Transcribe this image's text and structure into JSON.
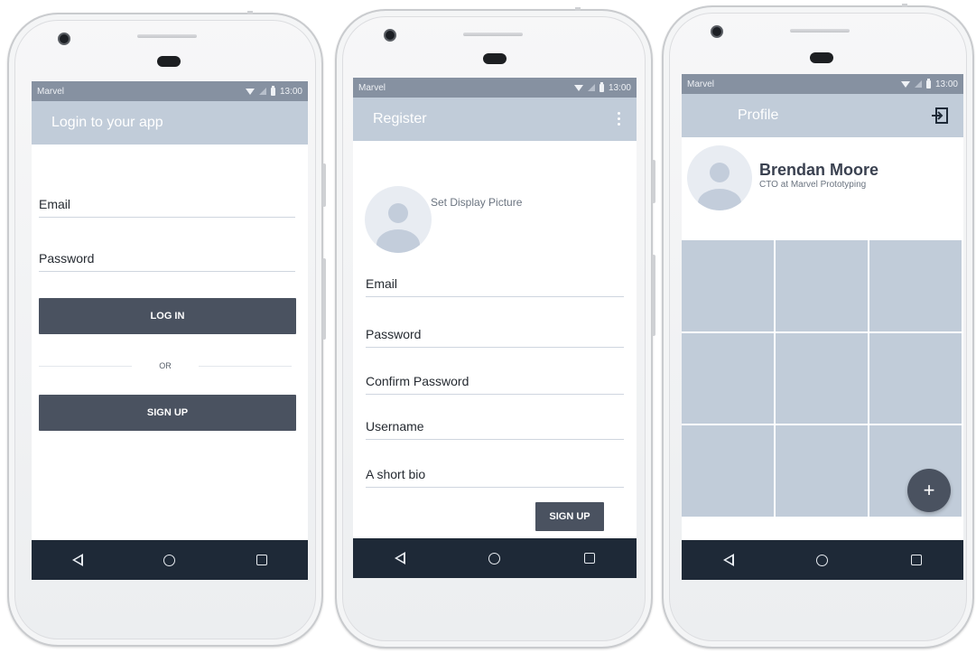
{
  "status_bar": {
    "carrier": "Marvel",
    "time": "13:00"
  },
  "login": {
    "title": "Login to your app",
    "email_label": "Email",
    "password_label": "Password",
    "login_button": "LOG IN",
    "or_label": "OR",
    "signup_button": "SIGN UP"
  },
  "register": {
    "title": "Register",
    "set_picture_label": "Set Display Picture",
    "email_label": "Email",
    "password_label": "Password",
    "confirm_password_label": "Confirm Password",
    "username_label": "Username",
    "bio_label": "A short bio",
    "signup_button": "SIGN UP"
  },
  "profile": {
    "title": "Profile",
    "name": "Brendan Moore",
    "subtitle": "CTO at Marvel Prototyping",
    "fab_label": "+"
  },
  "icons": {
    "status": [
      "wifi-icon",
      "signal-icon",
      "battery-icon"
    ],
    "nav": [
      "back-icon",
      "home-icon",
      "recent-apps-icon"
    ],
    "appbar": [
      "more-vert-icon",
      "exit-icon"
    ]
  },
  "colors": {
    "status_bar": "#8691a1",
    "app_bar": "#c1ccd9",
    "nav_bar": "#1e2937",
    "button": "#4a5260",
    "placeholder": "#c1ccd9"
  }
}
